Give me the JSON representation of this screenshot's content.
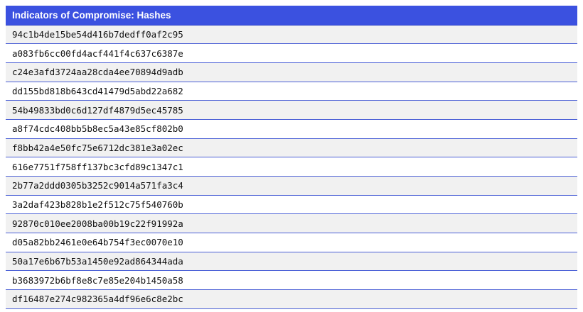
{
  "table": {
    "header": "Indicators of Compromise: Hashes",
    "rows": [
      "94c1b4de15be54d416b7dedff0af2c95",
      "a083fb6cc00fd4acf441f4c637c6387e",
      "c24e3afd3724aa28cda4ee70894d9adb",
      "dd155bd818b643cd41479d5abd22a682",
      "54b49833bd0c6d127df4879d5ec45785",
      "a8f74cdc408bb5b8ec5a43e85cf802b0",
      "f8bb42a4e50fc75e6712dc381e3a02ec",
      "616e7751f758ff137bc3cfd89c1347c1",
      "2b77a2ddd0305b3252c9014a571fa3c4",
      "3a2daf423b828b1e2f512c75f540760b",
      "92870c010ee2008ba00b19c22f91992a",
      "d05a82bb2461e0e64b754f3ec0070e10",
      "50a17e6b67b53a1450e92ad864344ada",
      "b3683972b6bf8e8c7e85e204b1450a58",
      "df16487e274c982365a4df96e6c8e2bc"
    ]
  },
  "colors": {
    "header_bg": "#3b51e0",
    "header_text": "#ffffff",
    "row_divider": "#4a5fd6",
    "row_alt_bg": "#f1f1f1"
  }
}
